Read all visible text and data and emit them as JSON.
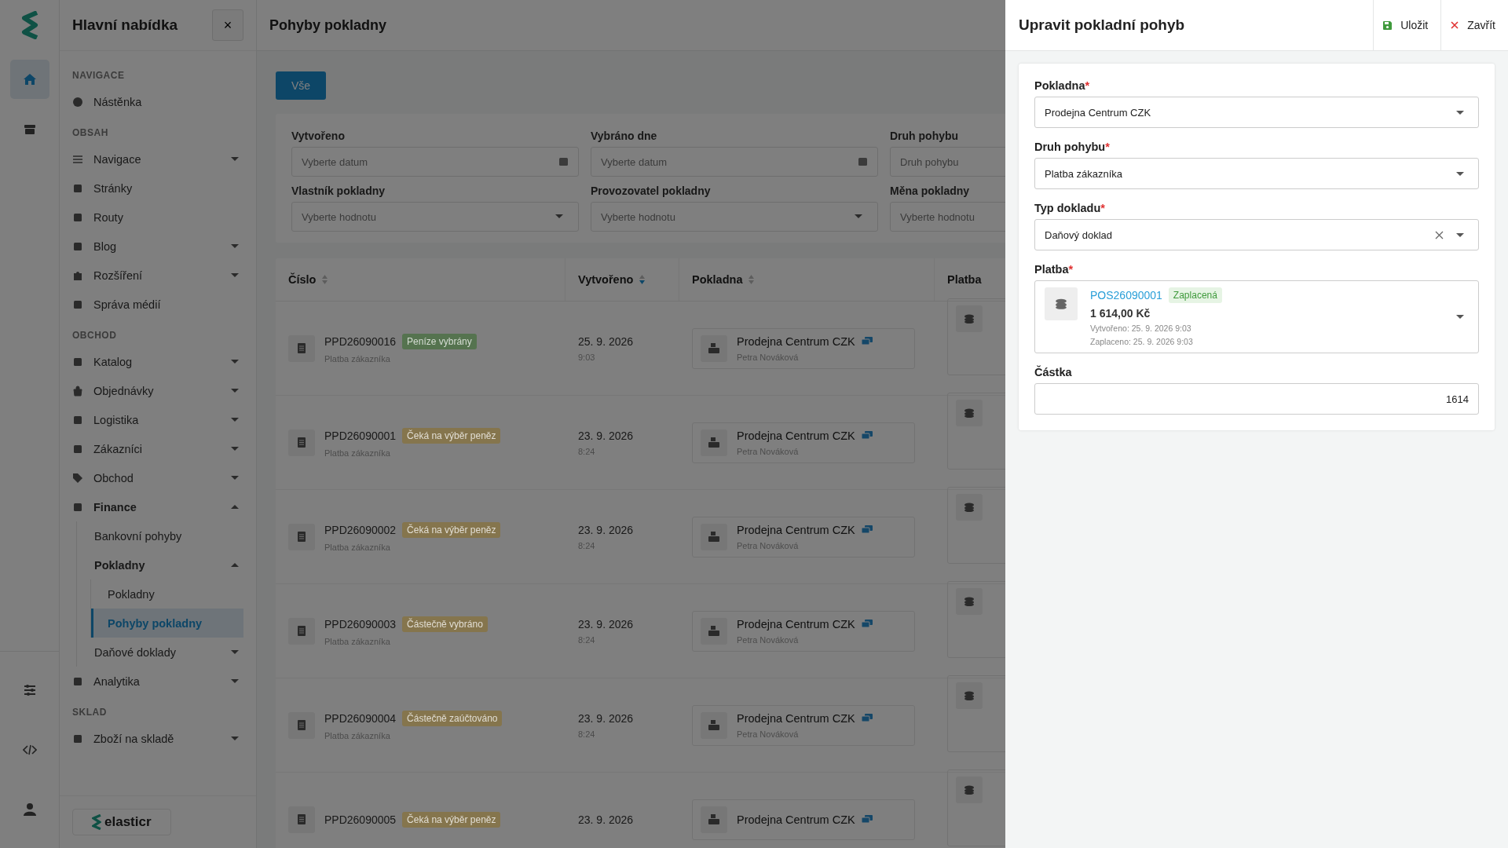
{
  "rail": {
    "items": [
      {
        "selected": true
      },
      {
        "selected": false
      }
    ],
    "bottom_items": [
      {
        "selected": false
      },
      {
        "selected": false
      },
      {
        "selected": false
      }
    ]
  },
  "sidebar": {
    "title": "Hlavní nabídka",
    "close": "×",
    "sections": [
      {
        "title": "NAVIGACE",
        "items": [
          {
            "label": "Nástěnka",
            "kind": "link",
            "selected": false
          }
        ]
      },
      {
        "title": "OBSAH",
        "items": [
          {
            "label": "Navigace",
            "kind": "group",
            "expanded": false,
            "selected": false
          },
          {
            "label": "Stránky",
            "kind": "link",
            "selected": false
          },
          {
            "label": "Routy",
            "kind": "link",
            "selected": false
          },
          {
            "label": "Blog",
            "kind": "group",
            "expanded": false,
            "selected": false
          },
          {
            "label": "Rozšíření",
            "kind": "group",
            "expanded": false,
            "selected": false
          },
          {
            "label": "Správa médií",
            "kind": "link",
            "selected": false
          }
        ]
      },
      {
        "title": "OBCHOD",
        "items": [
          {
            "label": "Katalog",
            "kind": "group",
            "expanded": false,
            "selected": false
          },
          {
            "label": "Objednávky",
            "kind": "group",
            "expanded": false,
            "selected": false
          },
          {
            "label": "Logistika",
            "kind": "group",
            "expanded": false,
            "selected": false
          },
          {
            "label": "Zákazníci",
            "kind": "group",
            "expanded": false,
            "selected": false
          },
          {
            "label": "Obchod",
            "kind": "group",
            "expanded": false,
            "selected": false
          },
          {
            "label": "Finance",
            "kind": "group",
            "expanded": true,
            "selected": false,
            "children": [
              {
                "label": "Bankovní pohyby",
                "kind": "link",
                "selected": false
              },
              {
                "label": "Pokladny",
                "kind": "group",
                "expanded": true,
                "selected": false,
                "children": [
                  {
                    "label": "Pokladny",
                    "selected": false
                  },
                  {
                    "label": "Pohyby pokladny",
                    "selected": true
                  }
                ]
              },
              {
                "label": "Daňové doklady",
                "kind": "group",
                "expanded": false,
                "selected": false
              }
            ]
          },
          {
            "label": "Analytika",
            "kind": "group",
            "expanded": false,
            "selected": false
          }
        ]
      },
      {
        "title": "SKLAD",
        "items": [
          {
            "label": "Zboží na skladě",
            "kind": "group",
            "expanded": false,
            "selected": false
          }
        ]
      }
    ],
    "logo_text": "elasticr"
  },
  "page": {
    "title": "Pohyby pokladny",
    "tabs": [
      {
        "label": "Vše",
        "selected": true
      }
    ]
  },
  "filters": [
    {
      "label": "Vytvořeno",
      "placeholder": "Vyberte datum",
      "kind": "date"
    },
    {
      "label": "Vybráno dne",
      "placeholder": "Vyberte datum",
      "kind": "date"
    },
    {
      "label": "Druh pohybu",
      "placeholder": "Druh pohybu",
      "kind": "text"
    },
    {
      "label": "Vlastník pokladny",
      "placeholder": "Vyberte hodnotu",
      "kind": "select"
    },
    {
      "label": "Provozovatel pokladny",
      "placeholder": "Vyberte hodnotu",
      "kind": "select"
    },
    {
      "label": "Měna pokladny",
      "placeholder": "Vyberte hodnotu",
      "kind": "select"
    }
  ],
  "table": {
    "columns": [
      {
        "label": "Číslo",
        "sorted": false
      },
      {
        "label": "Vytvořeno",
        "sorted": true
      },
      {
        "label": "Pokladna",
        "sorted": false
      },
      {
        "label": "Platba"
      }
    ],
    "rows": [
      {
        "number": "PPD26090016",
        "status": "Peníze vybrány",
        "color": "#55734f",
        "type": "Platba zákazníka",
        "date": "25. 9. 2026",
        "time": "9:03",
        "register": "Prodejna Centrum CZK",
        "owner": "Petra Nováková"
      },
      {
        "number": "PPD26090001",
        "status": "Čeká na výběr peněz",
        "color": "#85754d",
        "type": "Platba zákazníka",
        "date": "23. 9. 2026",
        "time": "8:24",
        "register": "Prodejna Centrum CZK",
        "owner": "Petra Nováková"
      },
      {
        "number": "PPD26090002",
        "status": "Čeká na výběr peněz",
        "color": "#85754d",
        "type": "Platba zákazníka",
        "date": "23. 9. 2026",
        "time": "8:24",
        "register": "Prodejna Centrum CZK",
        "owner": "Petra Nováková"
      },
      {
        "number": "PPD26090003",
        "status": "Částečně vybráno",
        "color": "#85754d",
        "type": "Platba zákazníka",
        "date": "23. 9. 2026",
        "time": "8:24",
        "register": "Prodejna Centrum CZK",
        "owner": "Petra Nováková"
      },
      {
        "number": "PPD26090004",
        "status": "Částečně zaúčtováno",
        "color": "#85754d",
        "type": "Platba zákazníka",
        "date": "23. 9. 2026",
        "time": "8:24",
        "register": "Prodejna Centrum CZK",
        "owner": "Petra Nováková"
      },
      {
        "number": "PPD26090005",
        "status": "Čeká na výběr peněz",
        "color": "#85754d",
        "date": "23. 9. 2026",
        "register": "Prodejna Centrum CZK"
      }
    ]
  },
  "drawer": {
    "title": "Upravit pokladní pohyb",
    "save": "Uložit",
    "close": "Zavřít",
    "fields": [
      {
        "label": "Pokladna",
        "required_mark": "*",
        "kind": "select",
        "value": "Prodejna Centrum CZK"
      },
      {
        "label": "Druh pohybu",
        "required_mark": "*",
        "kind": "select",
        "value": "Platba zákazníka"
      },
      {
        "label": "Typ dokladu",
        "required_mark": "*",
        "kind": "clearable",
        "value": "Daňový doklad"
      },
      {
        "label": "Platba",
        "required_mark": "*",
        "kind": "payment",
        "link": "POS26090001",
        "badge": "Zaplacená",
        "amount": "1 614,00 Kč",
        "created": "Vytvořeno: 25. 9. 2026 9:03",
        "paid": "Zaplaceno: 25. 9. 2026 9:03"
      },
      {
        "label": "Částka",
        "kind": "number",
        "value": "1614"
      }
    ]
  }
}
